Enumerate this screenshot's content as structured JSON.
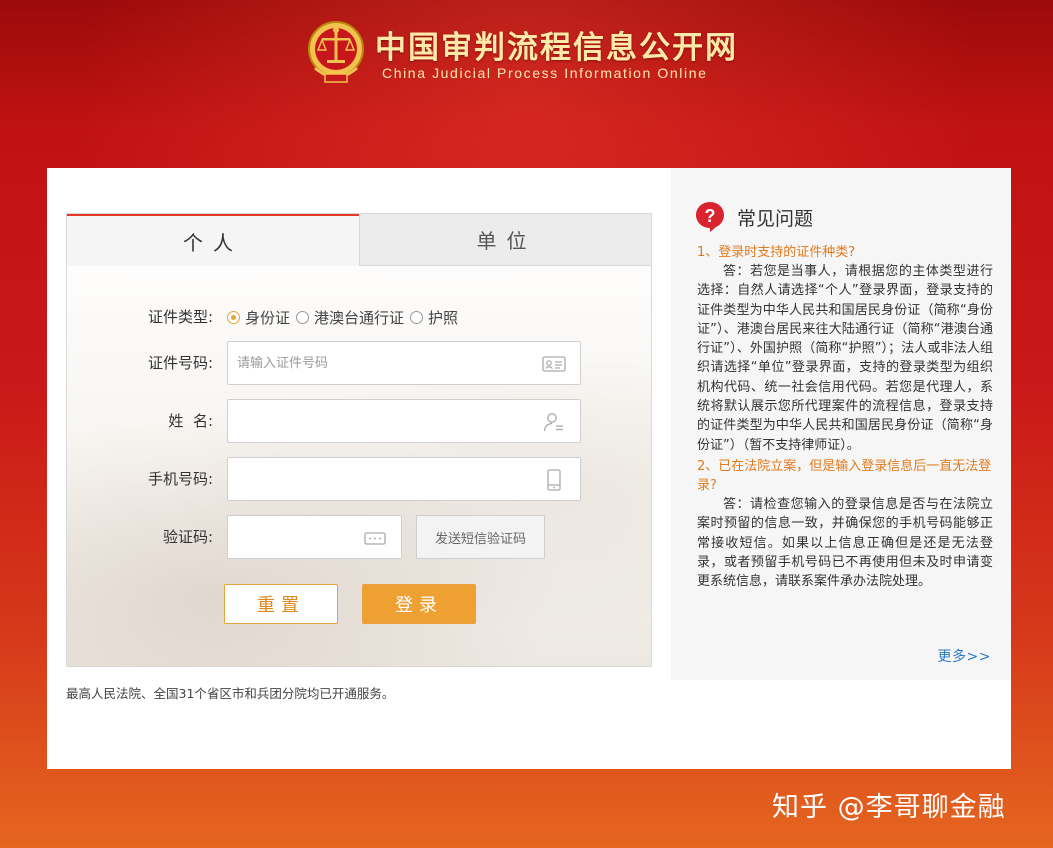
{
  "header": {
    "title": "中国审判流程信息公开网",
    "subtitle": "China Judicial Process Information Online"
  },
  "tabs": [
    {
      "label": "个人",
      "active": true
    },
    {
      "label": "单位",
      "active": false
    }
  ],
  "form": {
    "cert_type_label": "证件类型:",
    "cert_types": [
      "身份证",
      "港澳台通行证",
      "护照"
    ],
    "cert_type_selected": "身份证",
    "cert_no_label": "证件号码:",
    "cert_no_placeholder": "请输入证件号码",
    "name_label": "姓  名:",
    "phone_label": "手机号码:",
    "captcha_label": "验证码:",
    "sms_button": "发送短信验证码",
    "reset_button": "重置",
    "login_button": "登录"
  },
  "footer_note": "最高人民法院、全国31个省区市和兵团分院均已开通服务。",
  "faq": {
    "title": "常见问题",
    "items": [
      {
        "q": "1、登录时支持的证件种类?",
        "a": "答：若您是当事人，请根据您的主体类型进行选择：自然人请选择“个人”登录界面，登录支持的证件类型为中华人民共和国居民身份证（简称“身份证”）、港澳台居民来往大陆通行证（简称“港澳台通行证”）、外国护照（简称“护照”）；法人或非法人组织请选择“单位”登录界面，支持的登录类型为组织机构代码、统一社会信用代码。若您是代理人，系统将默认展示您所代理案件的流程信息，登录支持的证件类型为中华人民共和国居民身份证（简称“身份证”）（暂不支持律师证）。"
      },
      {
        "q": "2、已在法院立案，但是输入登录信息后一直无法登录?",
        "a": "答：请检查您输入的登录信息是否与在法院立案时预留的信息一致，并确保您的手机号码能够正常接收短信。如果以上信息正确但是还是无法登录，或者预留手机号码已不再使用但未及时申请变更系统信息，请联系案件承办法院处理。"
      }
    ],
    "more": "更多>>"
  },
  "watermark": "知乎 @李哥聊金融",
  "colors": {
    "accent_orange": "#eea033",
    "faq_question": "#e07a1e",
    "link_blue": "#2b7bc8",
    "header_gold": "#ffe9a8",
    "bg_red": "#c01212"
  },
  "icons": {
    "emblem": "court-emblem-icon",
    "cert_no": "id-card-icon",
    "name": "user-icon",
    "phone": "phone-icon",
    "captcha": "keyboard-icon",
    "faq": "question-icon"
  }
}
